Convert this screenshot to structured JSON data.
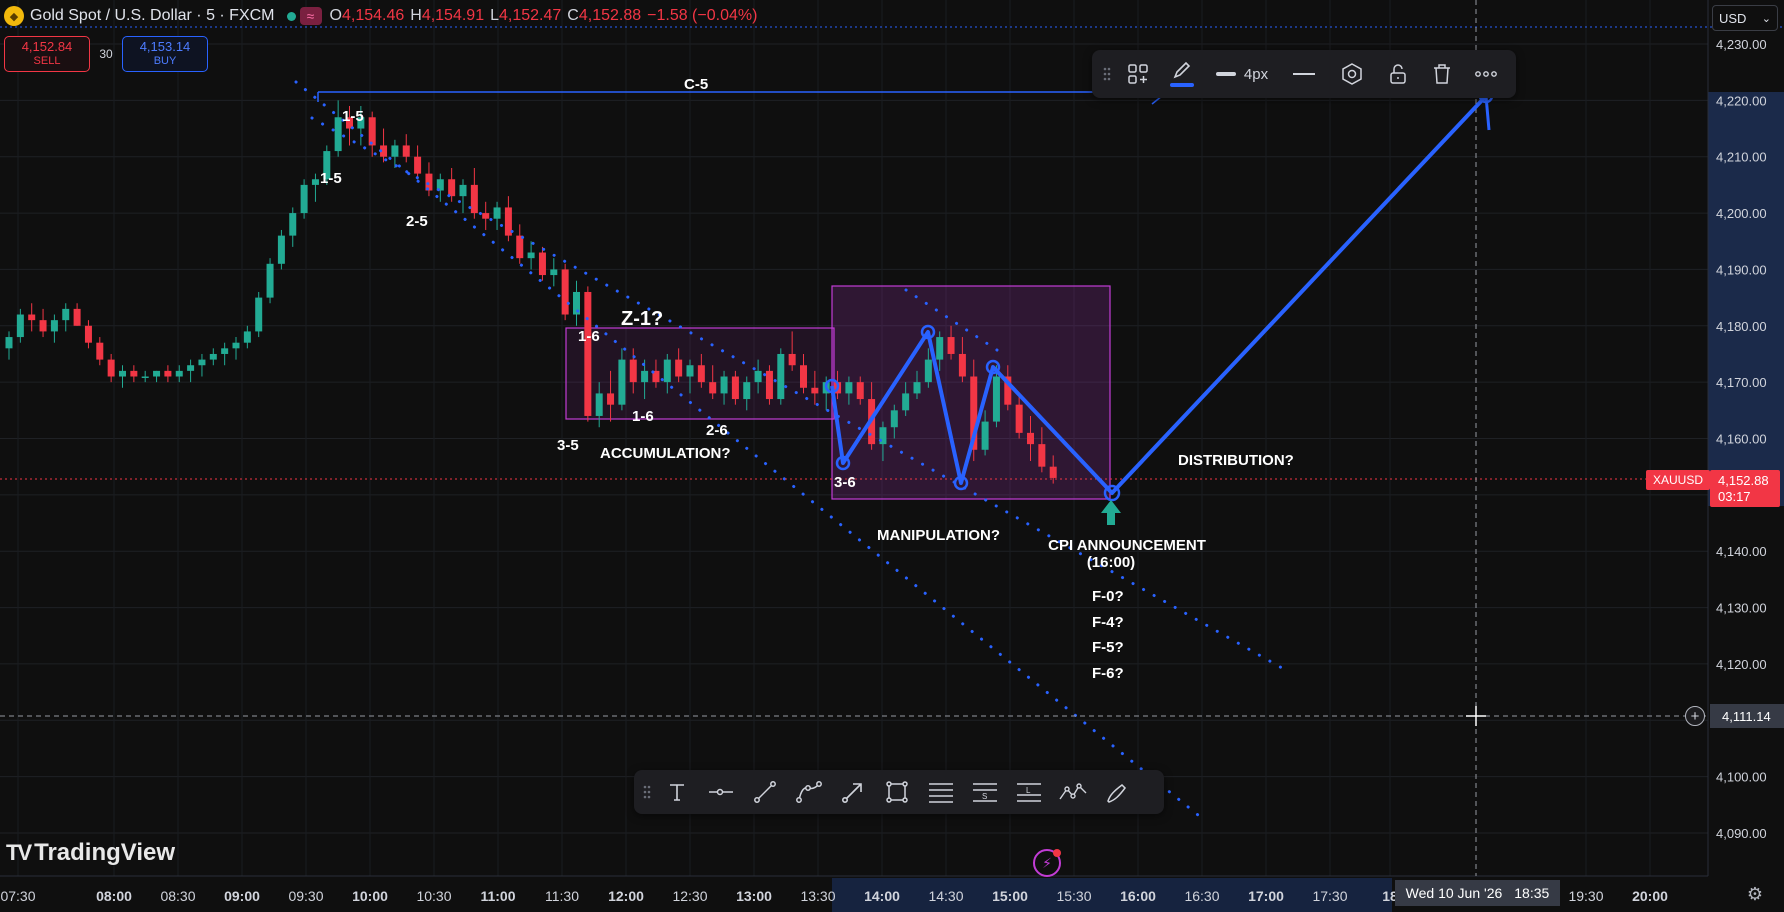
{
  "header": {
    "symbol_title": "Gold Spot / U.S. Dollar · 5 · FXCM",
    "open_label": "O",
    "open": "4,154.46",
    "high_label": "H",
    "high": "4,154.91",
    "low_label": "L",
    "low": "4,152.47",
    "close_label": "C",
    "close": "4,152.88",
    "change": "−1.58 (−0.04%)",
    "wave_glyph": "≈"
  },
  "trade": {
    "sell_price": "4,152.84",
    "sell_label": "SELL",
    "spread": "30",
    "buy_price": "4,153.14",
    "buy_label": "BUY"
  },
  "price_axis": {
    "currency": "USD",
    "labels": [
      "4,230.00",
      "4,220.00",
      "4,210.00",
      "4,200.00",
      "4,190.00",
      "4,180.00",
      "4,170.00",
      "4,160.00",
      "4,150.00",
      "4,140.00",
      "4,130.00",
      "4,120.00",
      "4,110.00",
      "4,100.00",
      "4,090.00"
    ],
    "symbol_tag": "XAUUSD",
    "last_price": "4,152.88",
    "countdown": "03:17",
    "crosshair_price": "4,111.14"
  },
  "time_axis": {
    "labels": [
      "07:30",
      "08:00",
      "08:30",
      "09:00",
      "09:30",
      "10:00",
      "10:30",
      "11:00",
      "11:30",
      "12:00",
      "12:30",
      "13:00",
      "13:30",
      "14:00",
      "14:30",
      "15:00",
      "15:30",
      "16:00",
      "16:30",
      "17:00",
      "17:30",
      "18",
      "19:30",
      "20:00"
    ],
    "crosshair_date": "Wed 10 Jun '26",
    "crosshair_time": "18:35"
  },
  "annotations": {
    "c5": "C-5",
    "top_1_5_a": "1-5",
    "top_1_5_b": "1-5",
    "l_2_5": "2-5",
    "l_3_5": "3-5",
    "l_1_6_a": "1-6",
    "l_1_6_b": "1-6",
    "l_2_6": "2-6",
    "l_3_6": "3-6",
    "z1": "Z-1?",
    "accumulation": "ACCUMULATION?",
    "manipulation": "MANIPULATION?",
    "distribution": "DISTRIBUTION?",
    "cpi": "CPI ANNOUNCEMENT",
    "cpi_time": "(16:00)",
    "f0": "F-0?",
    "f4": "F-4?",
    "f5": "F-5?",
    "f6": "F-6?"
  },
  "drawing_toolbar": {
    "width_label": "4px"
  },
  "chart_data": {
    "type": "candlestick",
    "symbol": "XAUUSD",
    "interval": "5",
    "y_range": [
      4085,
      4234
    ],
    "last_price": 4152.88
  },
  "colors": {
    "bull": "#22ab94",
    "bear": "#f23645",
    "drawing_blue": "#2962ff",
    "zone_magenta": "#c23cd6",
    "background": "#0f0f0f"
  },
  "brand": "TradingView"
}
